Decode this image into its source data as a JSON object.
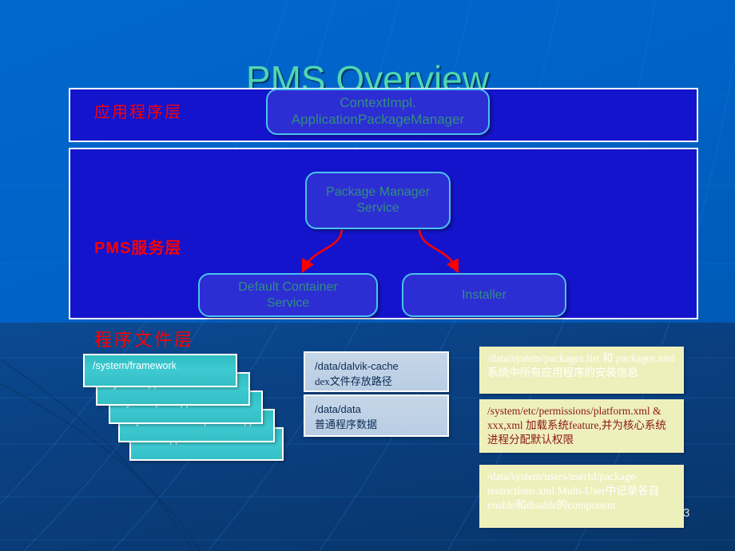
{
  "slide": {
    "title": "PMS Overview",
    "number": "3",
    "accent_teal": "#4fd6b0",
    "accent_red": "#ff0000",
    "panel_blue": "#1414cc",
    "note_yellow": "#eef0bc"
  },
  "layers": {
    "application": "应用程序层",
    "service": "PMS服务层",
    "files": "程序文件层"
  },
  "boxes": {
    "context": "ContextImpl.\nApplicationPackageManager",
    "context_line1": "ContextImpl.",
    "context_line2": "ApplicationPackageManager",
    "pms_line1": "Package Manager",
    "pms_line2": "Service",
    "dcs_line1": "Default Container",
    "dcs_line2": "Service",
    "installer": "Installer"
  },
  "paths": [
    {
      "label": "/system/framework"
    },
    {
      "label": "/system/app"
    },
    {
      "label": "/system/priv-app"
    },
    {
      "label": "/system/vendor/operator/app"
    },
    {
      "label": "/data/app"
    }
  ],
  "data_boxes": [
    {
      "line1": "/data/dalvik-cache",
      "line2": "dex文件存放路径"
    },
    {
      "line1": "/data/data",
      "line2": "普通程序数据"
    }
  ],
  "notes": [
    {
      "text": "/data/system/packages.list 和 packages.xml 系统中所有应用程序的安装信息"
    },
    {
      "text": "/system/etc/permissions/platform.xml & xxx,xml 加载系统feature,并为核心系统进程分配默认权限"
    },
    {
      "text": "/data/system/users/userId/package-restrictions.xml Multi-User中记录各自enable和disable的component"
    }
  ]
}
